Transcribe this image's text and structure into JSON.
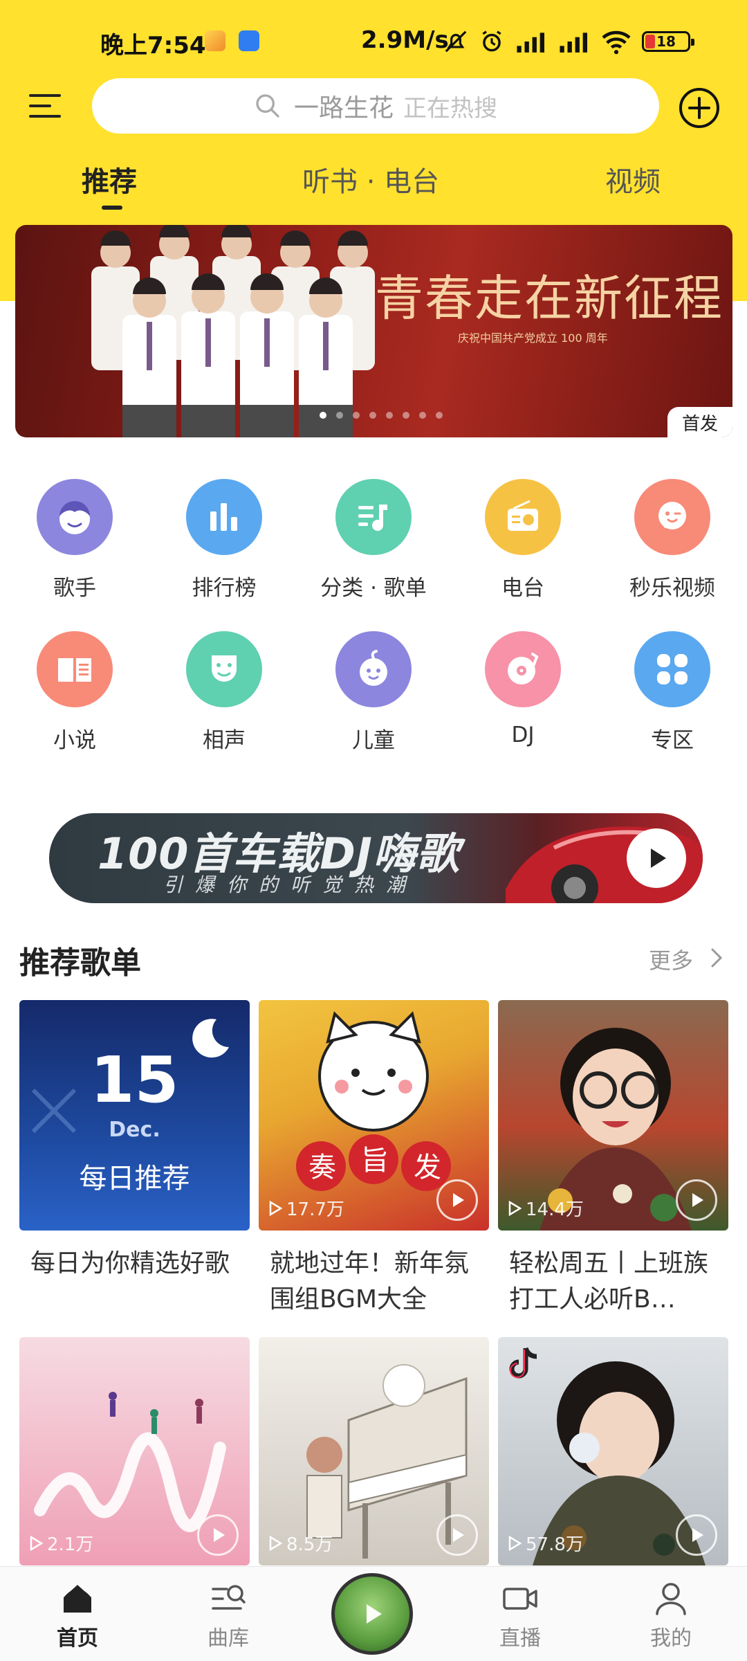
{
  "status_bar": {
    "time": "晚上7:54",
    "speed": "2.9M/s",
    "battery": "18"
  },
  "search": {
    "placeholder_main": "一路生花",
    "placeholder_sub": "正在热搜"
  },
  "tabs": [
    {
      "label": "推荐",
      "active": true
    },
    {
      "label": "听书 · 电台",
      "active": false
    },
    {
      "label": "视频",
      "active": false
    }
  ],
  "banner": {
    "title": "青春走在新征程",
    "subtitle": "庆祝中国共产党成立 100 周年",
    "badge": "首发",
    "dot_count": 8,
    "active_dot": 0
  },
  "categories": [
    {
      "label": "歌手",
      "icon": "singer-face-icon",
      "color": "#8C86DE"
    },
    {
      "label": "排行榜",
      "icon": "bar-chart-icon",
      "color": "#5AA8F0"
    },
    {
      "label": "分类 · 歌单",
      "icon": "playlist-note-icon",
      "color": "#5FD0B0"
    },
    {
      "label": "电台",
      "icon": "radio-icon",
      "color": "#F6C244"
    },
    {
      "label": "秒乐视频",
      "icon": "wink-face-icon",
      "color": "#F88A78"
    },
    {
      "label": "小说",
      "icon": "book-icon",
      "color": "#F88A78"
    },
    {
      "label": "相声",
      "icon": "mask-icon",
      "color": "#5FD0B0"
    },
    {
      "label": "儿童",
      "icon": "baby-face-icon",
      "color": "#8C86DE"
    },
    {
      "label": "DJ",
      "icon": "vinyl-icon",
      "color": "#F792A8"
    },
    {
      "label": "专区",
      "icon": "grid-icon",
      "color": "#5AA8F0"
    }
  ],
  "promo": {
    "title": "100首车载DJ嗨歌",
    "subtitle": "引爆你的听觉热潮"
  },
  "section": {
    "title": "推荐歌单",
    "more": "更多"
  },
  "playlists": [
    {
      "title": "每日为你精选好歌",
      "playcount": "",
      "daily_day": "15",
      "daily_month": "Dec.",
      "daily_label": "每日推荐"
    },
    {
      "title": "就地过年！新年氛围组BGM大全",
      "playcount": "17.7万"
    },
    {
      "title": "轻松周五丨上班族打工人必听B…",
      "playcount": "14.4万"
    },
    {
      "title": "",
      "playcount": "2.1万"
    },
    {
      "title": "",
      "playcount": "8.5万"
    },
    {
      "title": "",
      "playcount": "57.8万"
    }
  ],
  "bottom_nav": [
    {
      "label": "首页",
      "icon": "home-icon",
      "active": true
    },
    {
      "label": "曲库",
      "icon": "library-search-icon",
      "active": false
    },
    {
      "label": "",
      "icon": "now-playing-disc-icon",
      "active": false
    },
    {
      "label": "直播",
      "icon": "video-camera-icon",
      "active": false
    },
    {
      "label": "我的",
      "icon": "profile-icon",
      "active": false
    }
  ],
  "colors": {
    "header_yellow": "#FFE12E",
    "banner_red": "#8d1d18"
  }
}
